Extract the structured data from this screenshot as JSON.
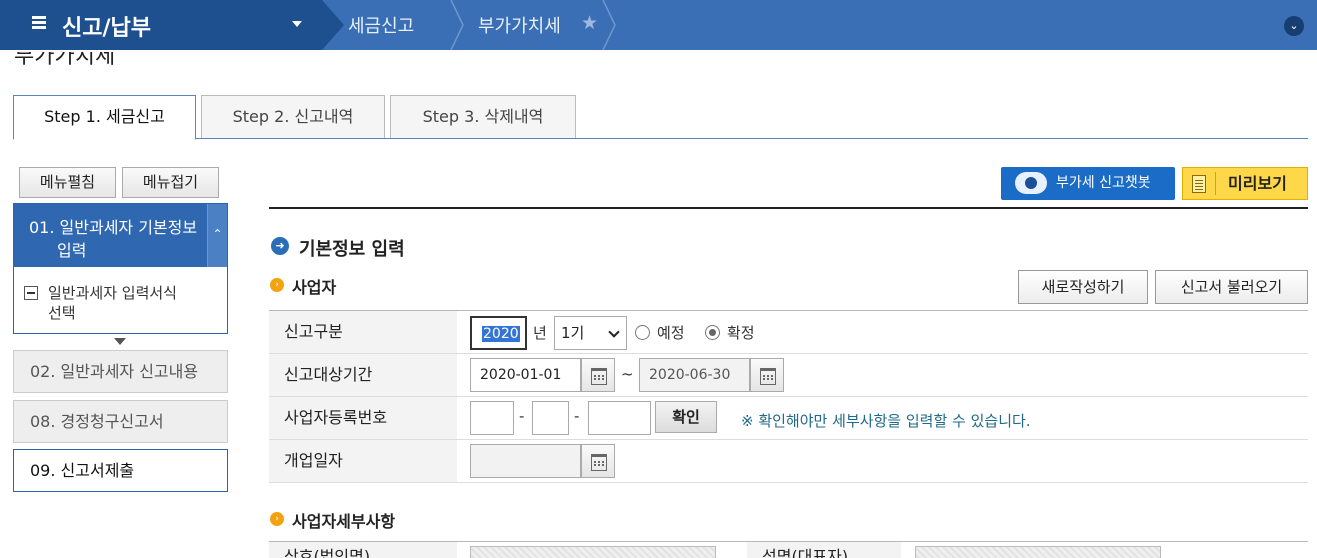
{
  "nav": {
    "home_title": "신고/납부",
    "breadcrumbs": [
      "세금신고",
      "부가가치세"
    ]
  },
  "page_title": "부가가치세",
  "tabs": [
    {
      "label": "Step 1. 세금신고",
      "active": true
    },
    {
      "label": "Step 2. 신고내역",
      "active": false
    },
    {
      "label": "Step 3. 삭제내역",
      "active": false
    }
  ],
  "side": {
    "expand_label": "메뉴펼침",
    "collapse_label": "메뉴접기",
    "active_line1": "01. 일반과세자 기본정보",
    "active_line2": "입력",
    "sub_line1": "일반과세자 입력서식",
    "sub_line2": "선택",
    "item_02": "02. 일반과세자 신고내용",
    "item_08": "08. 경정청구신고서",
    "item_09": "09. 신고서제출"
  },
  "header_buttons": {
    "chatbot": "부가세 신고챗봇",
    "preview": "미리보기"
  },
  "section": {
    "title": "기본정보 입력",
    "business_label": "사업자",
    "detail_label": "사업자세부사항",
    "new_button": "새로작성하기",
    "load_button": "신고서 불러오기"
  },
  "form": {
    "report_type_label": "신고구분",
    "year_value": "2020",
    "year_unit": "년",
    "period_option": "1기",
    "radio_preliminary": "예정",
    "radio_final": "확정",
    "radio_selected": "확정",
    "period_label": "신고대상기간",
    "period_start": "2020-01-01",
    "period_tilde": "~",
    "period_end": "2020-06-30",
    "bizno_label": "사업자등록번호",
    "dash": "-",
    "confirm_button": "확인",
    "bizno_note": "※ 확인해야만 세부사항을 입력할 수 있습니다.",
    "opening_label": "개업일자",
    "company_label": "상호(법인명)",
    "rep_label": "성명(대표자)"
  }
}
